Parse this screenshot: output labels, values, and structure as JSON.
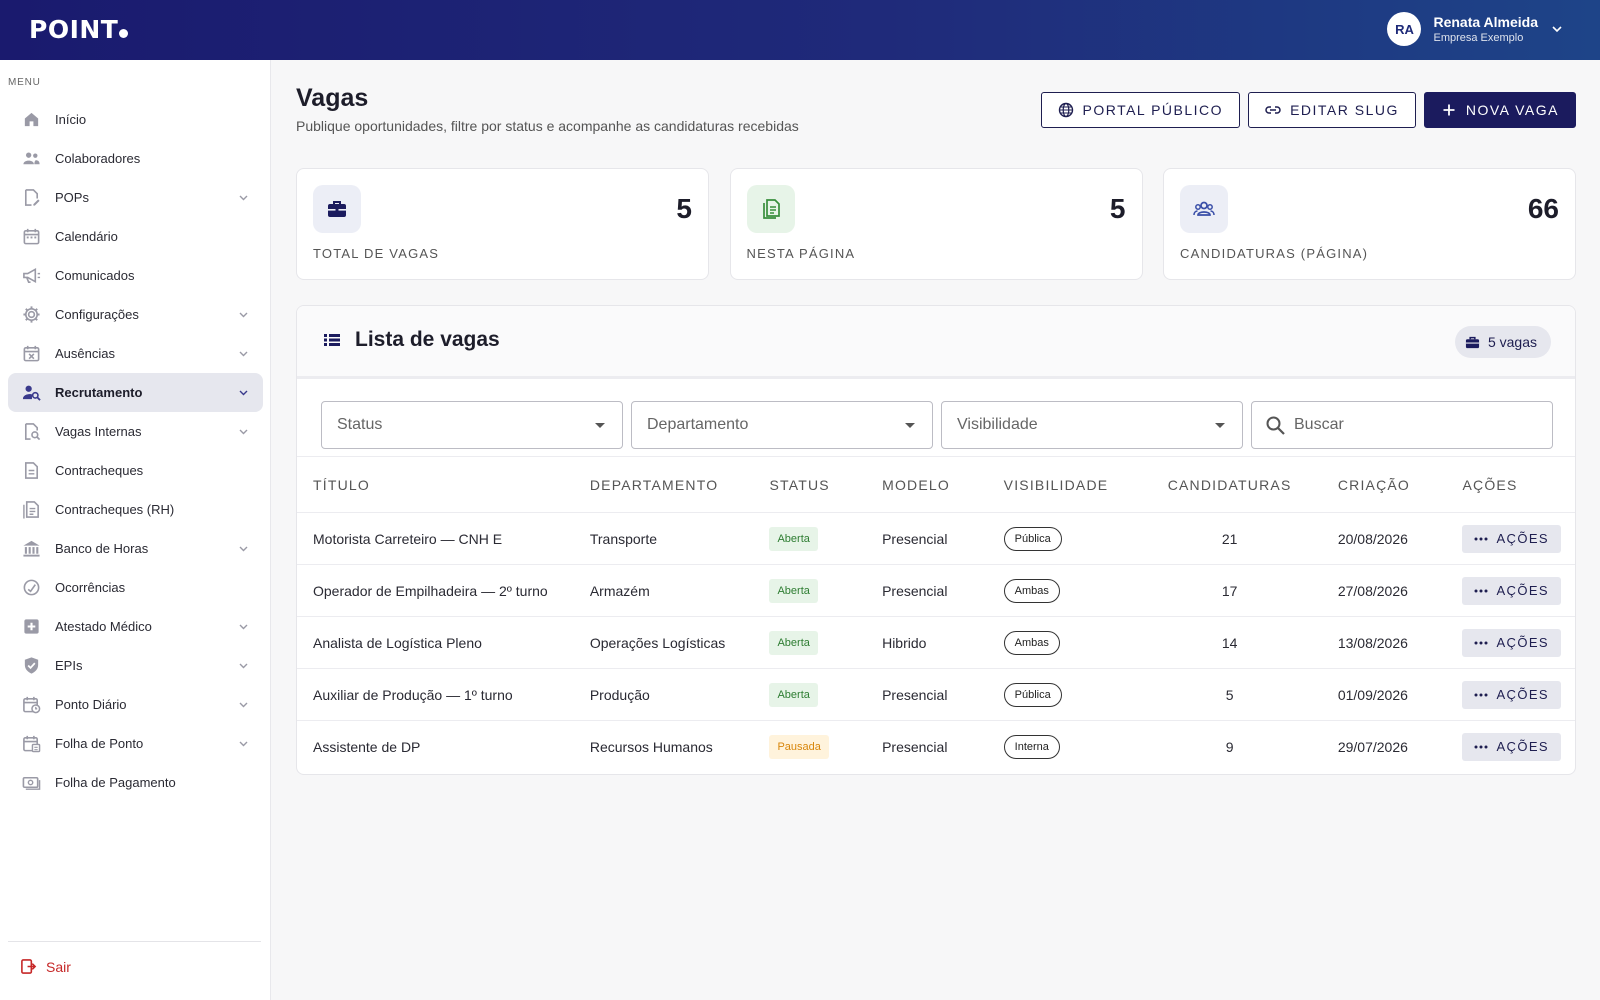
{
  "brand": {
    "logo": "POINT",
    "accent": "#1b1b5e"
  },
  "user": {
    "initials": "RA",
    "name": "Renata Almeida",
    "company": "Empresa Exemplo"
  },
  "sidebar": {
    "menu_label": "MENU",
    "items": [
      {
        "label": "Início",
        "icon": "home-icon",
        "chevron": false
      },
      {
        "label": "Colaboradores",
        "icon": "people-icon",
        "chevron": false
      },
      {
        "label": "POPs",
        "icon": "document-edit-icon",
        "chevron": true
      },
      {
        "label": "Calendário",
        "icon": "calendar-icon",
        "chevron": false
      },
      {
        "label": "Comunicados",
        "icon": "megaphone-icon",
        "chevron": false
      },
      {
        "label": "Configurações",
        "icon": "gear-icon",
        "chevron": true
      },
      {
        "label": "Ausências",
        "icon": "calendar-x-icon",
        "chevron": true
      },
      {
        "label": "Recrutamento",
        "icon": "person-search-icon",
        "chevron": true,
        "active": true
      },
      {
        "label": "Vagas Internas",
        "icon": "document-search-icon",
        "chevron": true
      },
      {
        "label": "Contracheques",
        "icon": "document-icon",
        "chevron": false
      },
      {
        "label": "Contracheques (RH)",
        "icon": "document-list-icon",
        "chevron": false
      },
      {
        "label": "Banco de Horas",
        "icon": "bank-icon",
        "chevron": true
      },
      {
        "label": "Ocorrências",
        "icon": "circle-check-icon",
        "chevron": false
      },
      {
        "label": "Atestado Médico",
        "icon": "medical-plus-icon",
        "chevron": true
      },
      {
        "label": "EPIs",
        "icon": "shield-icon",
        "chevron": true
      },
      {
        "label": "Ponto Diário",
        "icon": "calendar-clock-icon",
        "chevron": true
      },
      {
        "label": "Folha de Ponto",
        "icon": "calendar-grid-icon",
        "chevron": true
      },
      {
        "label": "Folha de Pagamento",
        "icon": "money-icon",
        "chevron": false
      }
    ],
    "logout": "Sair"
  },
  "page": {
    "title": "Vagas",
    "subtitle": "Publique oportunidades, filtre por status e acompanhe as candidaturas recebidas",
    "buttons": {
      "portal": "PORTAL PÚBLICO",
      "slug": "EDITAR SLUG",
      "new": "NOVA VAGA"
    }
  },
  "stats": [
    {
      "value": "5",
      "label": "TOTAL DE VAGAS",
      "icon": "briefcase-icon",
      "bg": "#eceef6",
      "color": "#1b1b5e"
    },
    {
      "value": "5",
      "label": "NESTA PÁGINA",
      "icon": "document-icon",
      "bg": "#e7f4e8",
      "color": "#388e3c"
    },
    {
      "value": "66",
      "label": "CANDIDATURAS (PÁGINA)",
      "icon": "group-icon",
      "bg": "#eceef6",
      "color": "#3a4fa8"
    }
  ],
  "list": {
    "title": "Lista de vagas",
    "count": "5 vagas",
    "filters": {
      "status": "Status",
      "department": "Departamento",
      "visibility": "Visibilidade",
      "search": "Buscar"
    },
    "columns": [
      "TÍTULO",
      "DEPARTAMENTO",
      "STATUS",
      "MODELO",
      "VISIBILIDADE",
      "CANDIDATURAS",
      "CRIAÇÃO",
      "AÇÕES"
    ],
    "action_label": "AÇÕES",
    "rows": [
      {
        "title": "Motorista Carreteiro — CNH E",
        "department": "Transporte",
        "status": "Aberta",
        "status_kind": "open",
        "model": "Presencial",
        "visibility": "Pública",
        "applications": "21",
        "created": "20/08/2026"
      },
      {
        "title": "Operador de Empilhadeira — 2º turno",
        "department": "Armazém",
        "status": "Aberta",
        "status_kind": "open",
        "model": "Presencial",
        "visibility": "Ambas",
        "applications": "17",
        "created": "27/08/2026"
      },
      {
        "title": "Analista de Logística Pleno",
        "department": "Operações Logísticas",
        "status": "Aberta",
        "status_kind": "open",
        "model": "Hibrido",
        "visibility": "Ambas",
        "applications": "14",
        "created": "13/08/2026"
      },
      {
        "title": "Auxiliar de Produção — 1º turno",
        "department": "Produção",
        "status": "Aberta",
        "status_kind": "open",
        "model": "Presencial",
        "visibility": "Pública",
        "applications": "5",
        "created": "01/09/2026"
      },
      {
        "title": "Assistente de DP",
        "department": "Recursos Humanos",
        "status": "Pausada",
        "status_kind": "paused",
        "model": "Presencial",
        "visibility": "Interna",
        "applications": "9",
        "created": "29/07/2026"
      }
    ]
  }
}
